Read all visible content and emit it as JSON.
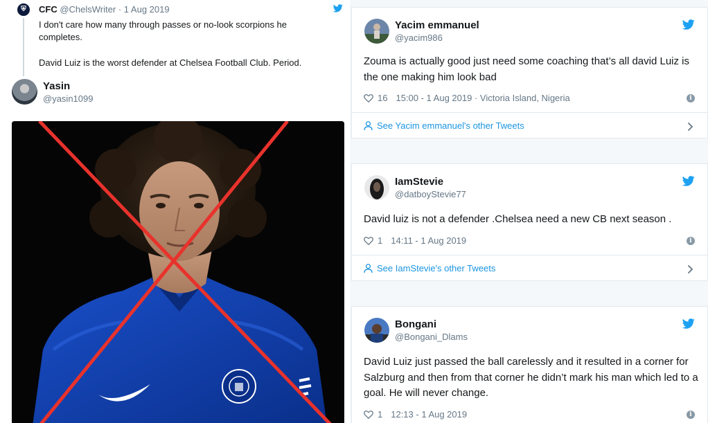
{
  "quoted_tweet": {
    "name": "CFC",
    "handle": "@ChelsWriter",
    "separator": "·",
    "date": "1 Aug 2019",
    "line1": "I don't care how many through passes or no-look scorpions he completes.",
    "line2": "David Luiz is the worst defender at Chelsea Football Club. Period."
  },
  "left_tweet": {
    "name": "Yasin",
    "handle": "@yasin1099"
  },
  "tweets": [
    {
      "name": "Yacim emmanuel",
      "handle": "@yacim986",
      "text": "Zouma is actually good just need some coaching that’s all david Luiz is the one making him look bad",
      "likes": "16",
      "timestamp": "15:00 - 1 Aug 2019",
      "location": "Victoria Island, Nigeria",
      "link": "See Yacim emmanuel's other Tweets"
    },
    {
      "name": "IamStevie",
      "handle": "@datboyStevie77",
      "text": "David luiz is not a defender .Chelsea need a new CB next season .",
      "likes": "1",
      "timestamp": "14:11 - 1 Aug 2019",
      "link": "See IamStevie's other Tweets"
    },
    {
      "name": "Bongani",
      "handle": "@Bongani_Dlams",
      "text": "David Luiz just passed the ball carelessly and it resulted in a corner for Salzburg and then from that corner he didn’t mark his man which led to a goal. He will never change.",
      "likes": "1",
      "timestamp": "12:13 - 1 Aug 2019"
    }
  ],
  "icons": {
    "twitter": "twitter-bird-icon",
    "like": "heart-icon",
    "info": "info-icon",
    "profile": "person-icon",
    "chevron": "chevron-right-icon"
  },
  "colors": {
    "twitter_blue": "#1da1f2",
    "link_blue": "#1b95e0",
    "muted": "#657786",
    "border": "#e1e8ed",
    "cross_red": "#e8322c",
    "kit_blue": "#0a3cae"
  }
}
